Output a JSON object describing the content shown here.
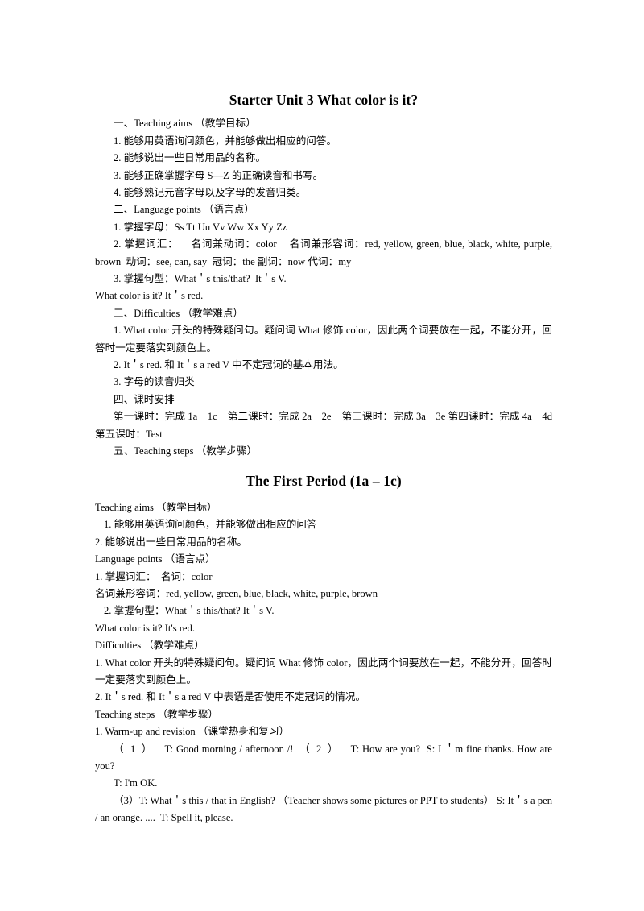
{
  "document": {
    "title": "Starter Unit 3 What color is it?",
    "period_title": "The First Period (1a – 1c)",
    "overview": {
      "teaching_aims_heading": "一、Teaching aims （教学目标）",
      "aim_1": "1. 能够用英语询问颜色，并能够做出相应的问答。",
      "aim_2": "2. 能够说出一些日常用品的名称。",
      "aim_3": "3. 能够正确掌握字母 S—Z 的正确读音和书写。",
      "aim_4": "4. 能够熟记元音字母以及字母的发音归类。",
      "language_points_heading": "二、Language points （语言点）",
      "lp_1": "1. 掌握字母：Ss Tt Uu Vv Ww Xx Yy Zz",
      "lp_2": "2. 掌握词汇：    名词兼动词：color    名词兼形容词：red, yellow, green, blue, black, white, purple, brown  动词：see, can, say  冠词：the 副词：now 代词：my",
      "lp_3": "3. 掌握句型：What＇s this/that?  It＇s V.",
      "lp_3b": "What color is it? It＇s red.",
      "difficulties_heading": "三、Difficulties （教学难点）",
      "diff_1": "1. What color 开头的特殊疑问句。疑问词 What 修饰 color，因此两个词要放在一起，不能分开，回答时一定要落实到颜色上。",
      "diff_2": "2. It＇s red. 和 It＇s a red V 中不定冠词的基本用法。",
      "diff_3": "3. 字母的读音归类",
      "schedule_heading": "四、课时安排",
      "schedule_line": "第一课时：完成 1a－1c    第二课时：完成 2a－2e    第三课时：完成 3a－3e 第四课时：完成 4a－4d 第五课时：Test",
      "teaching_steps_heading": "五、Teaching steps （教学步骤）"
    },
    "period": {
      "teaching_aims_heading": "Teaching aims （教学目标）",
      "aim_1": "1. 能够用英语询问颜色，并能够做出相应的问答",
      "aim_2": "2. 能够说出一些日常用品的名称。",
      "language_points_heading": "Language points （语言点）",
      "lp_1": "1. 掌握词汇：  名词：color",
      "lp_1b": "名词兼形容词：red, yellow, green, blue, black, white, purple, brown",
      "lp_2": "2. 掌握句型：What＇s this/that? It＇s V.",
      "lp_2b": "What color is it? It's red.",
      "difficulties_heading": "Difficulties （教学难点）",
      "diff_1": "1. What color 开头的特殊疑问句。疑问词 What 修饰 color，因此两个词要放在一起，不能分开，回答时一定要落实到颜色上。",
      "diff_2": "2. It＇s red. 和 It＇s a red V 中表语是否使用不定冠词的情况。",
      "teaching_steps_heading": "Teaching steps （教学步骤）",
      "step_1_heading": "1. Warm-up and revision （课堂热身和复习）",
      "dialogue_1": "（  1  ）    T: Good morning / afternoon /!  （  2  ）    T: How are you?  S: I ＇m fine thanks. How are you?",
      "dialogue_2": "T: I'm OK.",
      "dialogue_3": "（3）T: What＇s this / that in English? （Teacher shows some pictures or PPT to students） S: It＇s a pen / an orange. ....  T: Spell it, please."
    }
  }
}
